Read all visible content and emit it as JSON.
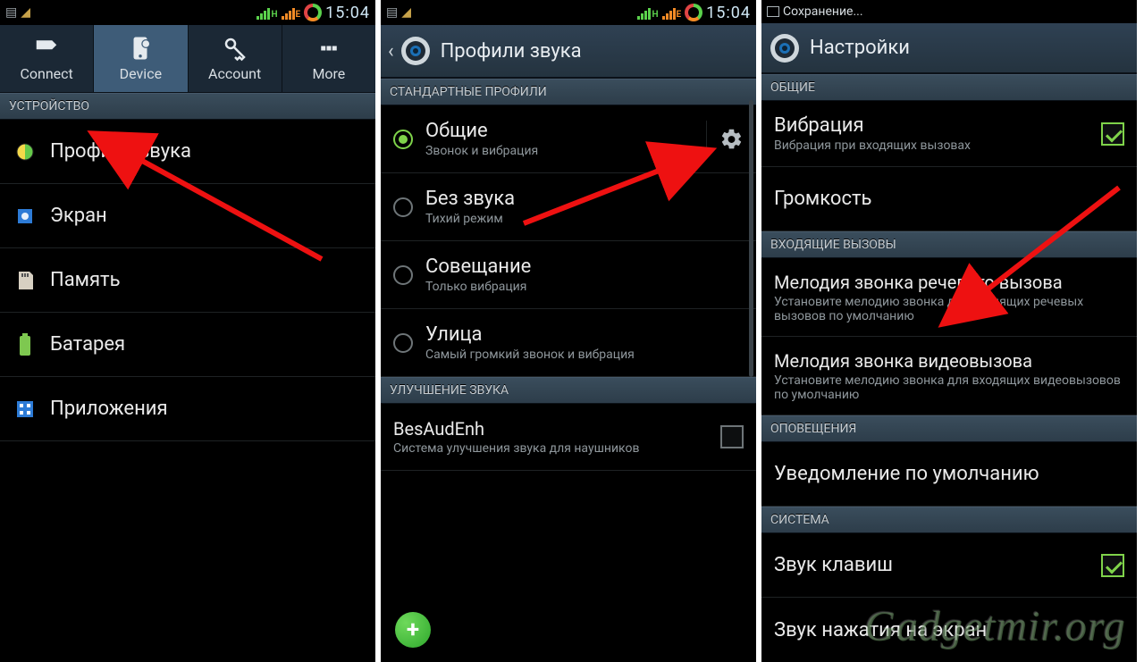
{
  "statusbar": {
    "time": "15:04",
    "saving": "Сохранение..."
  },
  "screen1": {
    "tabs": {
      "connect": "Connect",
      "device": "Device",
      "account": "Account",
      "more": "More"
    },
    "section_device": "УСТРОЙСТВО",
    "items": {
      "sound_profiles": "Профили звука",
      "display": "Экран",
      "storage": "Память",
      "battery": "Батарея",
      "apps": "Приложения"
    }
  },
  "screen2": {
    "title": "Профили звука",
    "section_std": "СТАНДАРТНЫЕ ПРОФИЛИ",
    "profiles": {
      "general": {
        "label": "Общие",
        "sub": "Звонок и вибрация"
      },
      "silent": {
        "label": "Без звука",
        "sub": "Тихий режим"
      },
      "meeting": {
        "label": "Совещание",
        "sub": "Только вибрация"
      },
      "outdoor": {
        "label": "Улица",
        "sub": "Самый громкий звонок и вибрация"
      }
    },
    "section_enh": "УЛУЧШЕНИЕ ЗВУКА",
    "enh": {
      "label": "BesAudEnh",
      "sub": "Система улучшения звука для наушников"
    }
  },
  "screen3": {
    "title": "Настройки",
    "section_general": "ОБЩИЕ",
    "vibration": {
      "label": "Вибрация",
      "sub": "Вибрация при входящих вызовах"
    },
    "volume": {
      "label": "Громкость"
    },
    "section_incoming": "ВХОДЯЩИЕ ВЫЗОВЫ",
    "voice_ringtone": {
      "label": "Мелодия звонка речевого вызова",
      "sub": "Установите мелодию звонка для входящих речевых вызовов по умолчанию"
    },
    "video_ringtone": {
      "label": "Мелодия звонка видеовызова",
      "sub": "Установите мелодию звонка для входящих видеовызовов по умолчанию"
    },
    "section_notif": "ОПОВЕЩЕНИЯ",
    "default_notif": {
      "label": "Уведомление по умолчанию"
    },
    "section_system": "СИСТЕМА",
    "key_sound": {
      "label": "Звук клавиш"
    },
    "touch_sound": {
      "label": "Звук нажатия на экран"
    }
  },
  "watermark": "Gadgetmir.org"
}
